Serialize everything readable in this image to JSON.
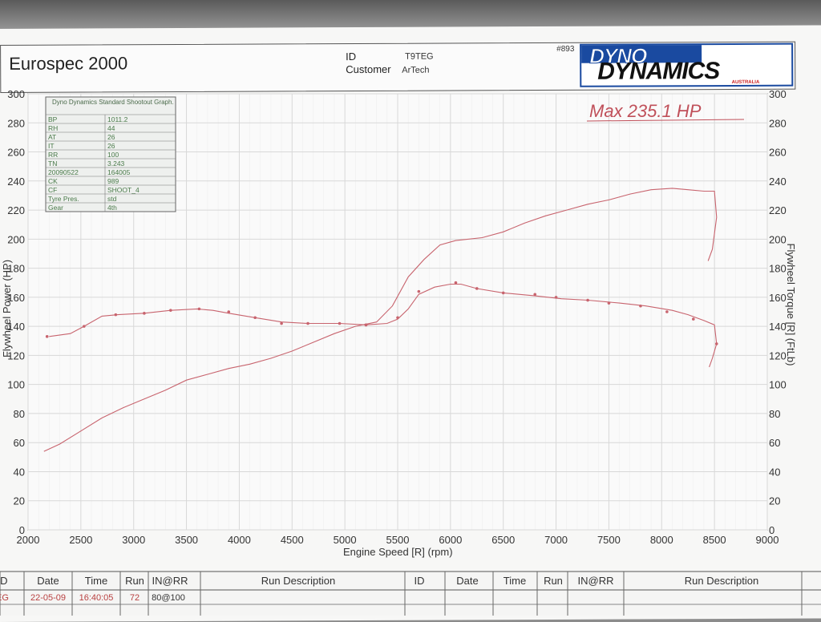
{
  "header": {
    "title": "Eurospec 2000",
    "id_label": "ID",
    "id_value": "T9TEG",
    "customer_label": "Customer",
    "customer_value": "ArTech",
    "run_number": "#893",
    "logo_line1": "DYNO",
    "logo_line2": "DYNAMICS",
    "logo_sub": "AUSTRALIA"
  },
  "info_box": {
    "heading": "Dyno Dynamics Standard Shootout Graph.",
    "rows": [
      [
        "BP",
        "1011.2"
      ],
      [
        "RH",
        "44"
      ],
      [
        "AT",
        "26"
      ],
      [
        "IT",
        "26"
      ],
      [
        "RR",
        "100"
      ],
      [
        "TN",
        "3.243"
      ],
      [
        "20090522",
        "164005"
      ],
      [
        "CK",
        "989"
      ],
      [
        "CF",
        "SHOOT_4"
      ],
      [
        "Tyre Pres.",
        "std"
      ],
      [
        "Gear",
        "4th"
      ]
    ]
  },
  "annotation": "Max 235.1 HP",
  "chart_data": {
    "type": "line",
    "xlabel": "Engine Speed [R] (rpm)",
    "ylabel": "Flywheel Power (HP)",
    "y2label": "Flywheel Torque [R] (FtLb)",
    "xlim": [
      2000,
      9000
    ],
    "ylim": [
      0,
      300
    ],
    "y2lim": [
      0,
      300
    ],
    "xticks": [
      2000,
      2500,
      3000,
      3500,
      4000,
      4500,
      5000,
      5500,
      6000,
      6500,
      7000,
      7500,
      8000,
      8500,
      9000
    ],
    "yticks": [
      0,
      20,
      40,
      60,
      80,
      100,
      120,
      140,
      160,
      180,
      200,
      220,
      240,
      260,
      280,
      300
    ],
    "grid": true,
    "series": [
      {
        "name": "Flywheel Power",
        "color": "#c8646e",
        "x": [
          2150,
          2300,
          2500,
          2700,
          2900,
          3100,
          3300,
          3500,
          3700,
          3900,
          4100,
          4300,
          4500,
          4700,
          4900,
          5100,
          5300,
          5450,
          5600,
          5750,
          5900,
          6050,
          6300,
          6500,
          6700,
          6900,
          7100,
          7300,
          7500,
          7700,
          7900,
          8100,
          8250,
          8400,
          8500,
          8520,
          8480,
          8440
        ],
        "values": [
          54,
          59,
          68,
          77,
          84,
          90,
          96,
          103,
          107,
          111,
          114,
          118,
          123,
          129,
          135,
          140,
          143,
          154,
          174,
          186,
          196,
          199,
          201,
          205,
          211,
          216,
          220,
          224,
          227,
          231,
          234,
          235,
          234,
          233,
          233,
          215,
          193,
          185
        ]
      },
      {
        "name": "Flywheel Torque",
        "color": "#c8646e",
        "x": [
          2200,
          2400,
          2530,
          2700,
          2850,
          3100,
          3350,
          3600,
          3750,
          3900,
          4150,
          4400,
          4650,
          4950,
          5200,
          5400,
          5500,
          5600,
          5700,
          5850,
          6000,
          6100,
          6250,
          6500,
          6800,
          7050,
          7300,
          7600,
          7850,
          8100,
          8250,
          8400,
          8500,
          8520,
          8480,
          8450
        ],
        "values": [
          133,
          135,
          140,
          147,
          148,
          149,
          151,
          152,
          151,
          149,
          146,
          143,
          142,
          142,
          141,
          142,
          145,
          152,
          162,
          167,
          169,
          169,
          166,
          163,
          161,
          159,
          158,
          156,
          154,
          151,
          148,
          144,
          141,
          128,
          118,
          112
        ]
      }
    ],
    "marked_power": [
      [
        5200,
        141
      ],
      [
        5500,
        146
      ],
      [
        5700,
        164
      ],
      [
        6050,
        170
      ],
      [
        6250,
        166
      ],
      [
        6500,
        163
      ],
      [
        6800,
        162
      ],
      [
        7000,
        160
      ],
      [
        7300,
        158
      ],
      [
        7500,
        156
      ],
      [
        7800,
        154
      ],
      [
        8050,
        150
      ],
      [
        8300,
        145
      ],
      [
        8520,
        128
      ]
    ],
    "marked_torque": [
      [
        2180,
        133
      ],
      [
        2530,
        140
      ],
      [
        2830,
        148
      ],
      [
        3100,
        149
      ],
      [
        3350,
        151
      ],
      [
        3620,
        152
      ],
      [
        3900,
        150
      ],
      [
        4150,
        146
      ],
      [
        4400,
        142
      ],
      [
        4650,
        142
      ],
      [
        4950,
        142
      ],
      [
        5200,
        141
      ]
    ]
  },
  "runs_table": {
    "headers": [
      "ID",
      "Date",
      "Time",
      "Run",
      "IN@RR",
      "Run Description",
      "ID",
      "Date",
      "Time",
      "Run",
      "IN@RR",
      "Run Description"
    ],
    "row": [
      "EG",
      "22-05-09",
      "16:40:05",
      "72",
      "80@100",
      ""
    ]
  }
}
